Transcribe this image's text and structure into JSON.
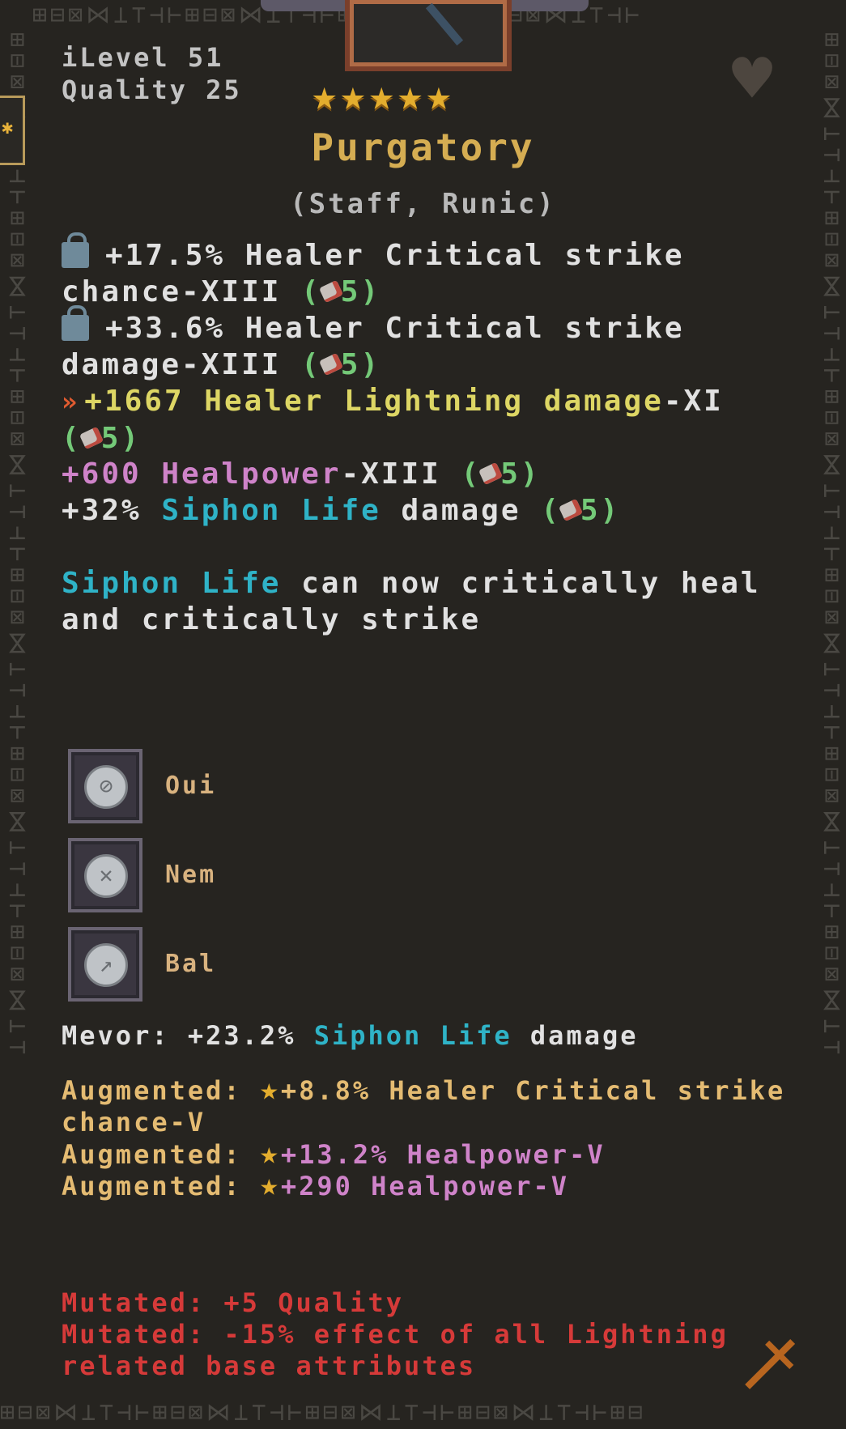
{
  "item": {
    "ilevel": "iLevel 51",
    "quality": "Quality 25",
    "stars": "★★★★★",
    "name": "Purgatory",
    "type": "(Staff, Runic)"
  },
  "stats": [
    {
      "value": "+17.5% Healer Critical strike",
      "cont": "chance-XIII",
      "gem": "(",
      "gem_count": "5)"
    },
    {
      "value": "+33.6% Healer Critical strike",
      "cont": "damage-XIII",
      "gem": "(",
      "gem_count": "5)"
    },
    {
      "value": "+1667 Healer Lightning damage",
      "suffix": "-XI",
      "gem": "(",
      "gem_count": "5)"
    },
    {
      "value": "+600 Healpower",
      "suffix": "-XIII",
      "gem": "(",
      "gem_count": "5)"
    },
    {
      "prefix": "+32% ",
      "skill": "Siphon Life",
      "rest": " damage ",
      "gem": "(",
      "gem_count": "5)"
    }
  ],
  "effect": {
    "skill": "Siphon Life",
    "line1_rest": " can now critically heal",
    "line2": "and critically strike"
  },
  "runes": [
    {
      "label": "Oui",
      "glyph": "⊘"
    },
    {
      "label": "Nem",
      "glyph": "✕"
    },
    {
      "label": "Bal",
      "glyph": "↗"
    }
  ],
  "mevor": {
    "prefix": "Mevor: +23.2% ",
    "skill": "Siphon Life",
    "rest": " damage"
  },
  "augments": [
    {
      "label": "Augmented:",
      "value": "+8.8% Healer Critical strike",
      "cont": "chance-V"
    },
    {
      "label": "Augmented:",
      "value": "+13.2% Healpower-V"
    },
    {
      "label": "Augmented:",
      "value": "+290 Healpower-V"
    }
  ],
  "mutations": [
    "Mutated: +5 Quality",
    "Mutated: -15% effect of all Lightning",
    "related base attributes"
  ],
  "icons": {
    "heart": "♥",
    "sword": "†",
    "tab": "✱",
    "star": "★"
  },
  "colors": {
    "name": "#d5ad52",
    "stat_white": "#e1e1e1",
    "lightning": "#ddd664",
    "healpower": "#cf83c9",
    "skill": "#2fb3c7",
    "gem": "#74c978",
    "augment": "#e4bb72",
    "mutation": "#d63a39"
  }
}
